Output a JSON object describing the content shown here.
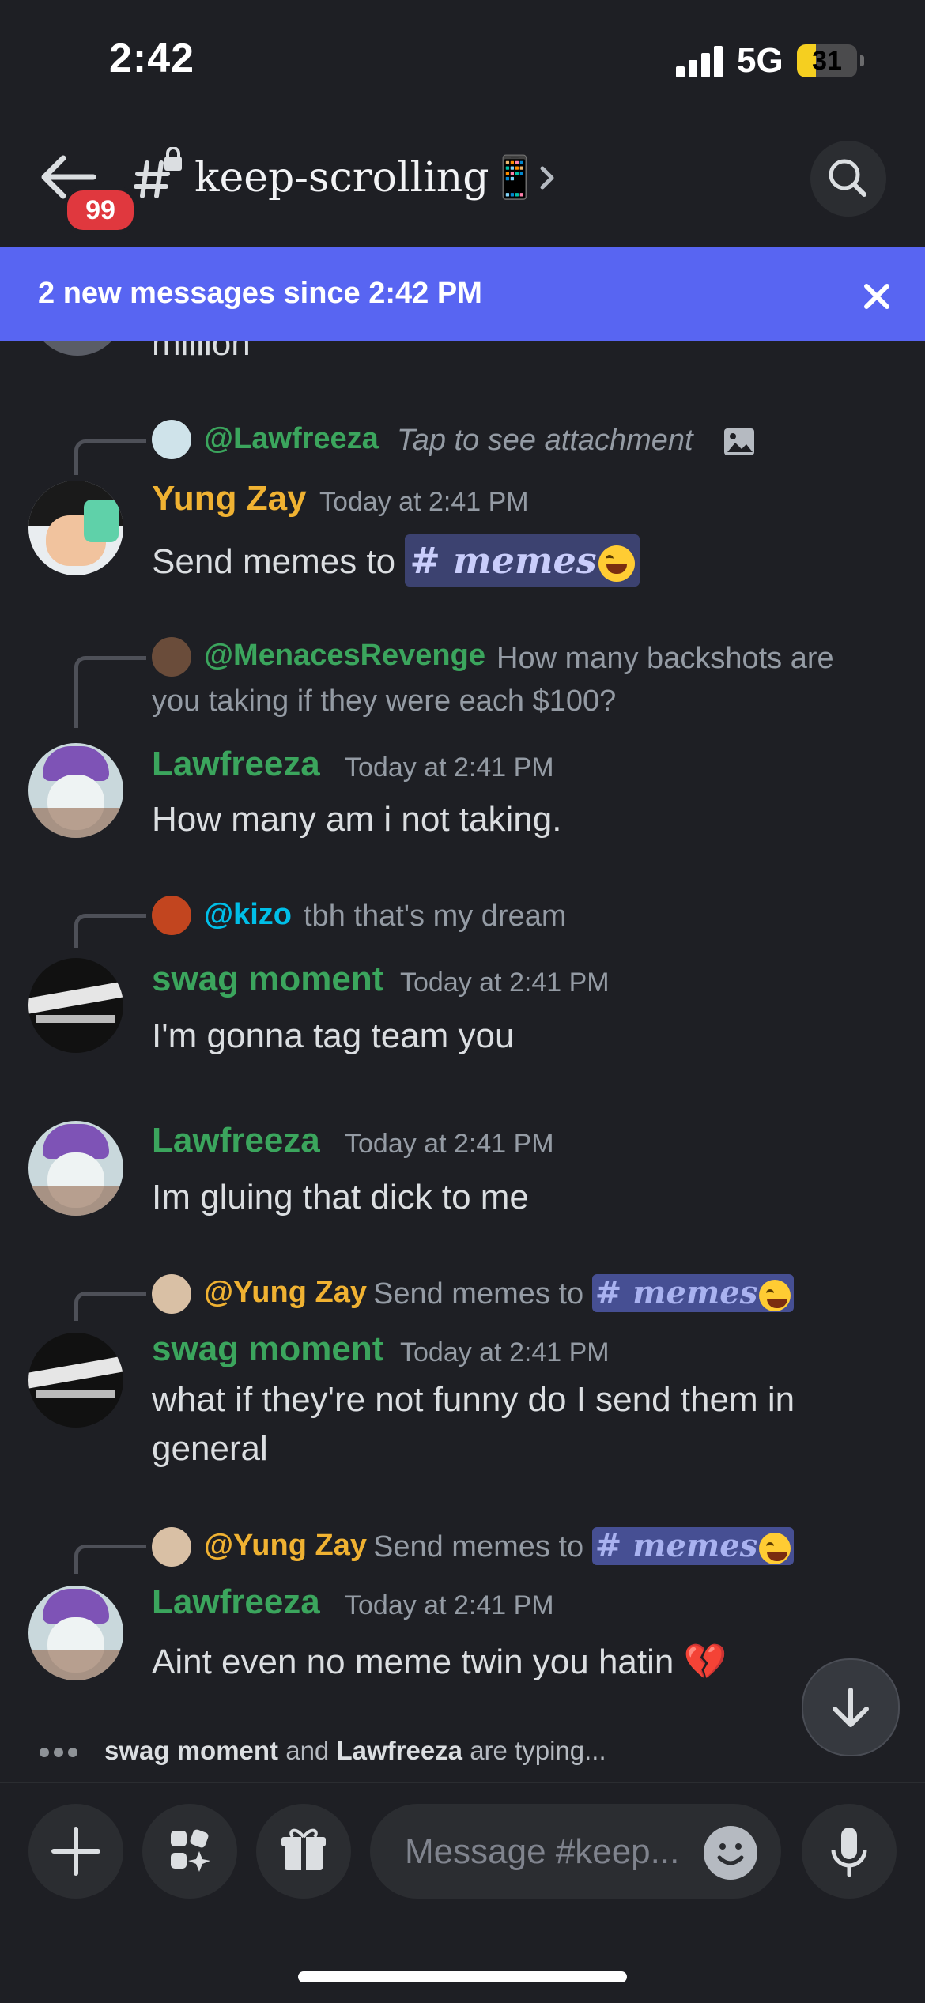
{
  "status_bar": {
    "time": "2:42",
    "network": "5G",
    "battery": "31",
    "battery_level": 0.31
  },
  "header": {
    "badge": "99",
    "channel_name": "keep-scrolling",
    "channel_emoji": "📱"
  },
  "banner": {
    "text": "2 new messages since 2:42 PM"
  },
  "partial_message": {
    "text": "million"
  },
  "messages": [
    {
      "reply_user": "@Lawfreeza",
      "reply_text": "Tap to see attachment",
      "username": "Yung Zay",
      "timestamp": "Today at 2:41 PM",
      "text": "Send memes to ",
      "channel_mention": "# memes"
    },
    {
      "reply_user": "@MenacesRevenge",
      "reply_text": "How many backshots are you taking if they were each $100?",
      "username": "Lawfreeza",
      "timestamp": "Today at 2:41 PM",
      "text": "How many am i not taking."
    },
    {
      "reply_user": "@kizo",
      "reply_text": "tbh that's my dream",
      "username": "swag moment",
      "timestamp": "Today at 2:41 PM",
      "text": "I'm gonna tag team you"
    },
    {
      "username": "Lawfreeza",
      "timestamp": "Today at 2:41 PM",
      "text": "Im gluing that dick to me"
    },
    {
      "reply_user": "@Yung Zay",
      "reply_text": "Send memes to",
      "reply_mention": "# memes",
      "username": "swag moment",
      "timestamp": "Today at 2:41 PM",
      "text": "what if they're not funny do I send them in general"
    },
    {
      "reply_user": "@Yung Zay",
      "reply_text": "Send memes to",
      "reply_mention": "# memes",
      "username": "Lawfreeza",
      "timestamp": "Today at 2:41 PM",
      "text": "Aint even no meme twin you hatin ",
      "emoji": "💔"
    }
  ],
  "typing": {
    "user1": "swag moment",
    "joiner": " and ",
    "user2": "Lawfreeza",
    "suffix": " are typing..."
  },
  "composer": {
    "placeholder": "Message #keep..."
  },
  "colors": {
    "accent": "#5865f2",
    "green_name": "#3ba55d",
    "gold_name": "#f0b232",
    "cyan_name": "#00bfe8",
    "background": "#1e1f24"
  },
  "icons": [
    "back-arrow-icon",
    "hash-lock-icon",
    "chevron-right-icon",
    "search-icon",
    "close-icon",
    "image-icon",
    "arrow-down-icon",
    "plus-icon",
    "apps-icon",
    "gift-icon",
    "emoji-icon",
    "microphone-icon"
  ]
}
